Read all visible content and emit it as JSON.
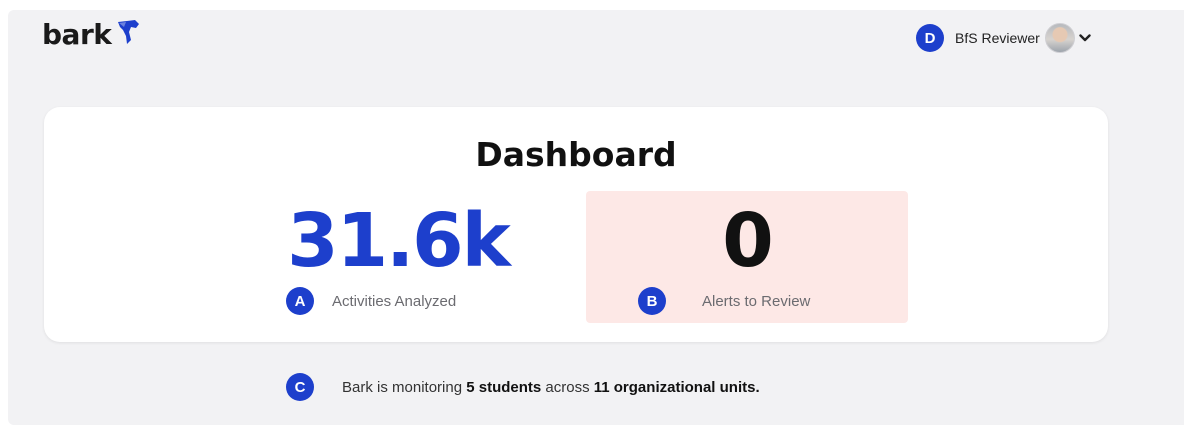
{
  "header": {
    "logo_text": "bark",
    "logo_icon": "bark-dog-icon",
    "user": {
      "marker": "D",
      "name": "BfS Reviewer",
      "avatar_icon": "user-avatar",
      "menu_icon": "chevron-down-icon"
    }
  },
  "dashboard": {
    "title": "Dashboard",
    "activities": {
      "value": "31.6k",
      "label": "Activities Analyzed",
      "marker": "A",
      "color": "#1d3fcc"
    },
    "alerts": {
      "value": "0",
      "label": "Alerts to Review",
      "marker": "B",
      "background": "#fde8e6"
    }
  },
  "footer": {
    "marker": "C",
    "text_before": "Bark is monitoring ",
    "students": "5 students",
    "text_middle": " across ",
    "units": "11 organizational units.",
    "text_after": ""
  },
  "colors": {
    "brand_blue": "#1d3fcc",
    "page_background": "#f2f2f4",
    "card_background": "#ffffff"
  }
}
